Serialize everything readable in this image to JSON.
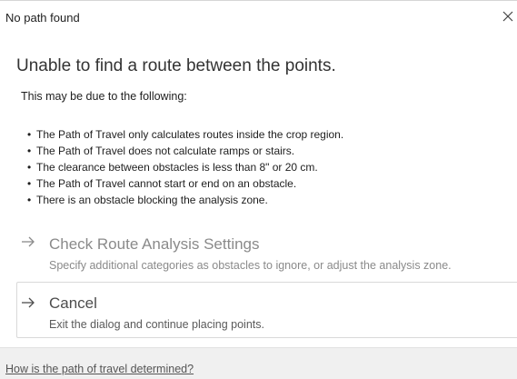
{
  "window": {
    "title": "No path found",
    "close_icon": "close-icon"
  },
  "main": {
    "heading": "Unable to find a route between the points.",
    "intro": "This may be due to the following:",
    "reasons": [
      "The Path of Travel only calculates routes inside the crop region.",
      "The Path of Travel does not calculate ramps or stairs.",
      "The clearance between obstacles is less than 8\" or 20 cm.",
      "The Path of Travel cannot start or end on an obstacle.",
      "There is an obstacle blocking the analysis zone."
    ],
    "bullet": "•"
  },
  "commands": {
    "settings": {
      "icon": "arrow-right-icon",
      "label": "Check Route Analysis Settings",
      "description": "Specify additional categories as obstacles to ignore, or adjust the analysis zone."
    },
    "cancel": {
      "icon": "arrow-right-icon",
      "label": "Cancel",
      "description": "Exit the dialog and continue placing points."
    }
  },
  "footer": {
    "help_link": "How is the path of travel determined?"
  },
  "colors": {
    "footer_bg": "#f0f0f0",
    "disabled_text": "#8a8a8a",
    "border": "#d9d9d9"
  }
}
